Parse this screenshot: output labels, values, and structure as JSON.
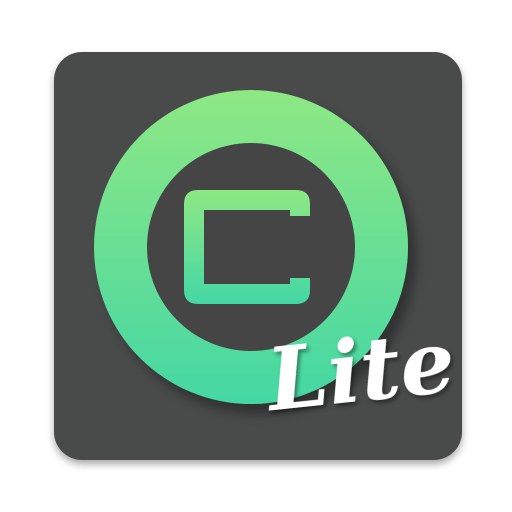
{
  "app_icon": {
    "icon_name": "app-launcher-icon",
    "badge_text": "Lite",
    "colors": {
      "background": "#ffffff",
      "tile": "#4a4b4b",
      "tile_shadow": "#3a3b3b",
      "ring_gradient_top": "#8ee884",
      "ring_gradient_bottom": "#44d7a4",
      "inner_disc": "#444545",
      "badge_text": "#ffffff"
    }
  }
}
